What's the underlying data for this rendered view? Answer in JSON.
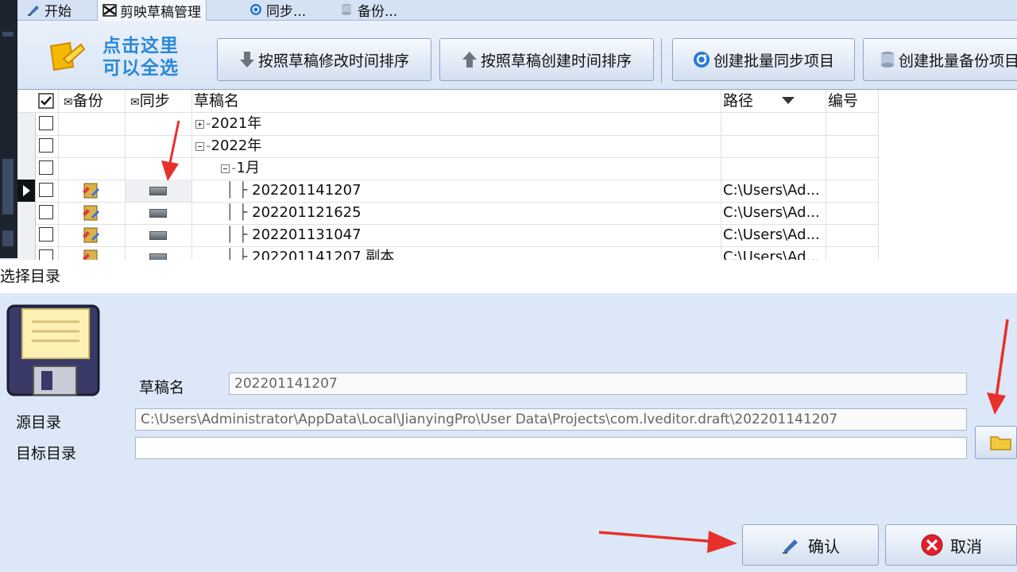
{
  "tabs": [
    "开始",
    "剪映草稿管理",
    "同步...",
    "备份..."
  ],
  "toolbar": {
    "select_all_hint_line1": "点击这里",
    "select_all_hint_line2": "可以全选",
    "sort_by_modified": "按照草稿修改时间排序",
    "sort_by_created": "按照草稿创建时间排序",
    "create_batch_sync": "创建批量同步项目",
    "create_batch_backup": "创建批量备份项目"
  },
  "grid": {
    "columns": {
      "backup": "备份",
      "sync": "同步",
      "name": "草稿名",
      "path": "路径",
      "number": "编号"
    },
    "rows": [
      {
        "name": "2021年",
        "path": ""
      },
      {
        "name": "2022年",
        "path": ""
      },
      {
        "name": "1月",
        "path": ""
      },
      {
        "name": "202201141207",
        "path": "C:\\Users\\Ad..."
      },
      {
        "name": "202201121625",
        "path": "C:\\Users\\Ad..."
      },
      {
        "name": "202201131047",
        "path": "C:\\Users\\Ad..."
      },
      {
        "name": "202201141207 副本",
        "path": "C:\\Users\\Ad..."
      }
    ]
  },
  "dialog": {
    "title": "选择目录",
    "draft_name_label": "草稿名",
    "draft_name_value": "202201141207",
    "source_dir_label": "源目录",
    "source_dir_value": "C:\\Users\\Administrator\\AppData\\Local\\JianyingPro\\User Data\\Projects\\com.lveditor.draft\\202201141207",
    "target_dir_label": "目标目录",
    "target_dir_value": "",
    "confirm_label": "确认",
    "cancel_label": "取消"
  },
  "colors": {
    "annotation_arrow": "#e8302a",
    "hint_text": "#2b88d8",
    "dialog_bg": "#dce8f8"
  }
}
